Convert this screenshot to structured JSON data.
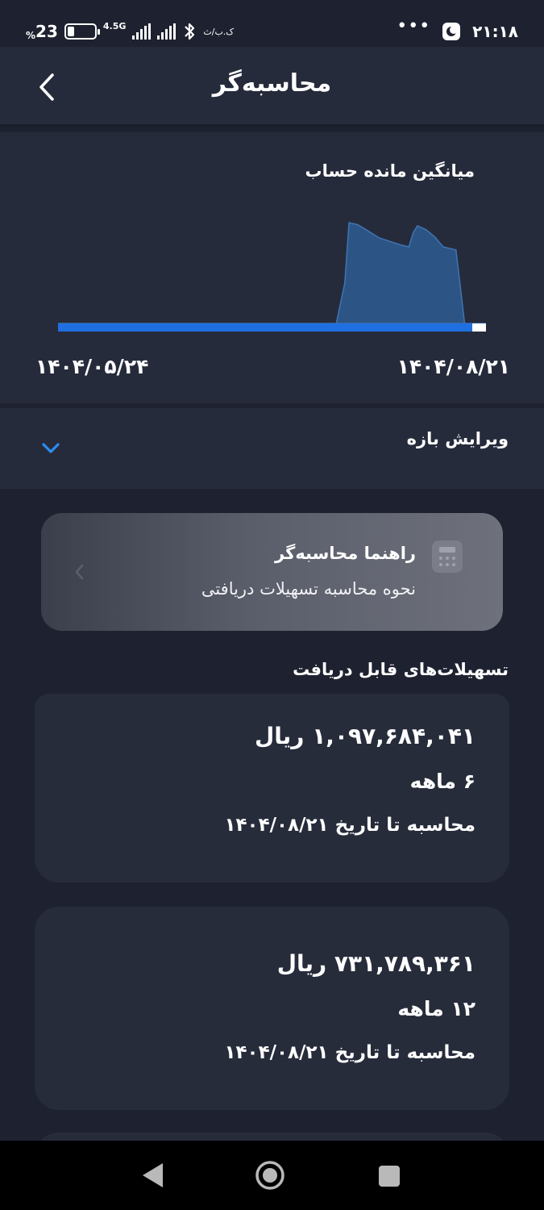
{
  "status_bar": {
    "battery_percent": "23",
    "percent_sign": "%",
    "network_type": "4.5G",
    "speed": "ک.ب/ث",
    "dots": "•••",
    "time": "۲۱:۱۸"
  },
  "header": {
    "title": "محاسبه‌گر"
  },
  "chart": {
    "title": "میانگین مانده حساب",
    "start_date": "۱۴۰۴/۰۵/۲۴",
    "end_date": "۱۴۰۴/۰۸/۲۱"
  },
  "chart_data": {
    "type": "area",
    "title": "میانگین مانده حساب",
    "x_labels": [
      "۱۴۰۴/۰۵/۲۴",
      "۱۴۰۴/۰۸/۲۱"
    ],
    "x": [
      0,
      0.1,
      0.2,
      0.3,
      0.4,
      0.5,
      0.6,
      0.65,
      0.67,
      0.68,
      0.7,
      0.72,
      0.75,
      0.8,
      0.82,
      0.83,
      0.84,
      0.86,
      0.88,
      0.9,
      0.93,
      0.95,
      0.96,
      1.0
    ],
    "values": [
      0,
      0,
      0,
      0,
      0,
      0,
      0,
      0,
      0.4,
      1.0,
      0.98,
      0.93,
      0.85,
      0.78,
      0.76,
      0.9,
      0.97,
      0.93,
      0.86,
      0.76,
      0.73,
      0.0,
      0.0,
      0.0
    ],
    "color": "#2f5f9e",
    "range_bar_color": "#1f6fe0",
    "grid": false
  },
  "range": {
    "label": "ویرایش بازه"
  },
  "guide": {
    "title": "راهنما محاسبه‌گر",
    "subtitle": "نحوه محاسبه تسهیلات دریافتی"
  },
  "section": {
    "title": "تسهیلات‌های قابل دریافت"
  },
  "loans": [
    {
      "amount": "۱,۰۹۷,۶۸۴,۰۴۱ ریال",
      "period": "۶ ماهه",
      "date": "محاسبه تا تاریخ ۱۴۰۴/۰۸/۲۱"
    },
    {
      "amount": "۷۳۱,۷۸۹,۳۶۱ ریال",
      "period": "۱۲ ماهه",
      "date": "محاسبه تا تاریخ ۱۴۰۴/۰۸/۲۱"
    }
  ]
}
